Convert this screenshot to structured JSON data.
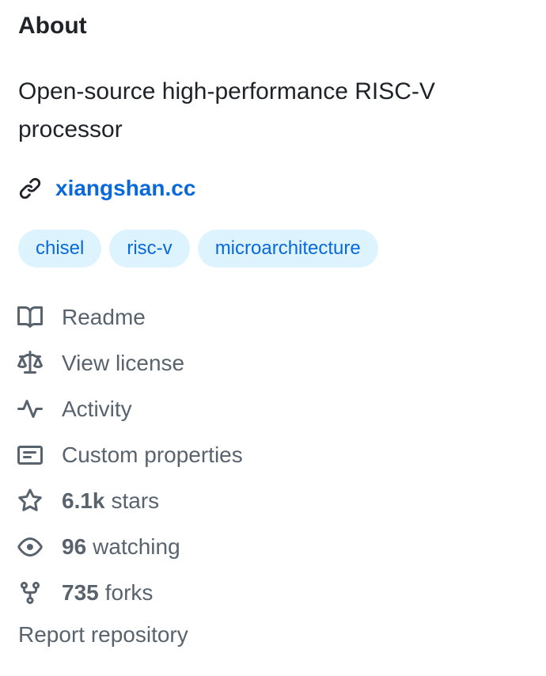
{
  "about": {
    "title": "About",
    "description": "Open-source high-performance RISC-V processor",
    "website": "xiangshan.cc",
    "topics": [
      "chisel",
      "risc-v",
      "microarchitecture"
    ],
    "links": {
      "readme": "Readme",
      "license": "View license",
      "activity": "Activity",
      "custom_properties": "Custom properties"
    },
    "stats": {
      "stars_count": "6.1k",
      "stars_label": "stars",
      "watching_count": "96",
      "watching_label": "watching",
      "forks_count": "735",
      "forks_label": "forks"
    },
    "report": "Report repository"
  },
  "colors": {
    "link": "#0969da",
    "topic_bg": "#ddf4ff",
    "muted": "#59636e",
    "text": "#1f2328"
  },
  "icons": [
    "link-icon",
    "book-icon",
    "law-icon",
    "pulse-icon",
    "note-icon",
    "star-icon",
    "eye-icon",
    "repo-forked-icon"
  ]
}
